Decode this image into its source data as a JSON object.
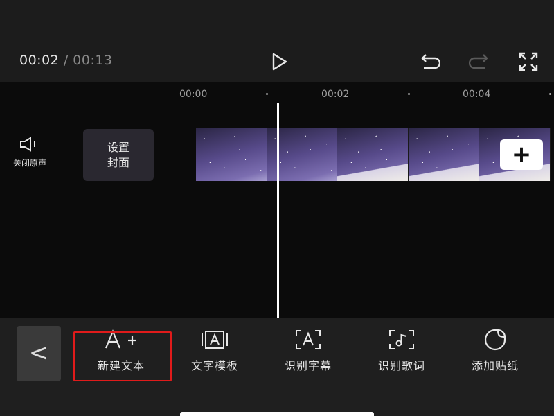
{
  "player": {
    "current_time": "00:02",
    "separator": "/",
    "total_time": "00:13"
  },
  "ruler": {
    "ticks": [
      "00:00",
      "00:02",
      "00:04"
    ]
  },
  "track": {
    "mute_label": "关闭原声",
    "cover_line1": "设置",
    "cover_line2": "封面",
    "add_symbol": "+"
  },
  "toolbar": {
    "back_symbol": "<",
    "items": [
      {
        "label": "新建文本",
        "icon": "add-text-icon"
      },
      {
        "label": "文字模板",
        "icon": "text-template-icon"
      },
      {
        "label": "识别字幕",
        "icon": "recognize-subtitles-icon"
      },
      {
        "label": "识别歌词",
        "icon": "recognize-lyrics-icon"
      },
      {
        "label": "添加贴纸",
        "icon": "sticker-icon"
      }
    ]
  },
  "colors": {
    "highlight": "#e01b1b",
    "background": "#111111",
    "toolbar": "#1f1f1f"
  }
}
